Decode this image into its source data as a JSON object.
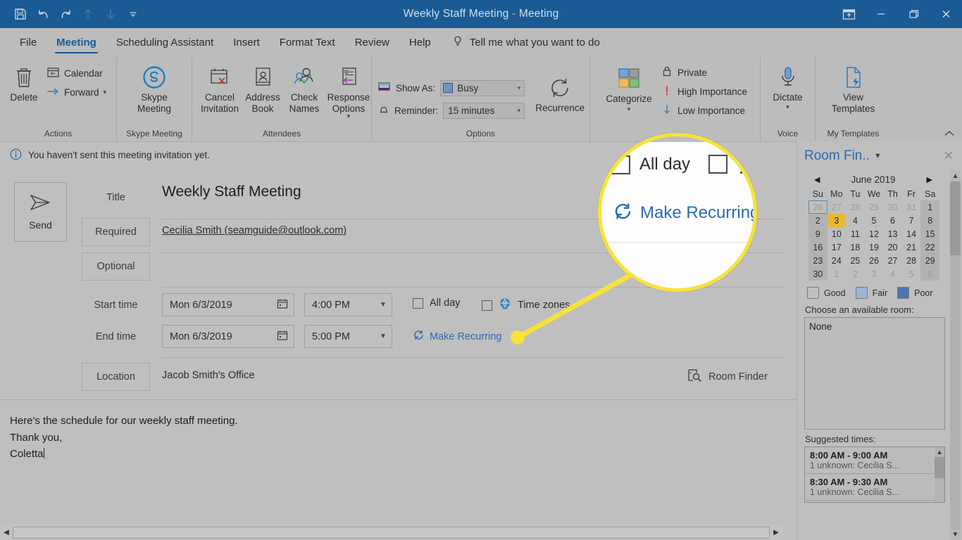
{
  "window": {
    "title": "Weekly Staff Meeting",
    "title_separator": "-",
    "title_suffix": "Meeting",
    "quick_access": [
      {
        "name": "save-icon",
        "label": "Save"
      },
      {
        "name": "undo-icon",
        "label": "Undo"
      },
      {
        "name": "redo-icon",
        "label": "Redo"
      },
      {
        "name": "previous-item-icon",
        "label": "Previous Item"
      },
      {
        "name": "next-item-icon",
        "label": "Next Item"
      },
      {
        "name": "customize-quick-access-toolbar-icon",
        "label": "Customize Quick Access Toolbar"
      }
    ],
    "controls": [
      {
        "name": "ribbon-display-options-icon",
        "label": "Ribbon Display Options"
      },
      {
        "name": "minimize-icon",
        "label": "Minimize"
      },
      {
        "name": "restore-icon",
        "label": "Restore Down"
      },
      {
        "name": "close-icon",
        "label": "Close"
      }
    ]
  },
  "tabs": [
    {
      "label": "File",
      "active": false
    },
    {
      "label": "Meeting",
      "active": true
    },
    {
      "label": "Scheduling Assistant",
      "active": false
    },
    {
      "label": "Insert",
      "active": false
    },
    {
      "label": "Format Text",
      "active": false
    },
    {
      "label": "Review",
      "active": false
    },
    {
      "label": "Help",
      "active": false
    }
  ],
  "tell_me": {
    "label": "Tell me what you want to do",
    "icon": "lightbulb-icon"
  },
  "ribbon": {
    "collapse_label": "Collapse the Ribbon",
    "groups": [
      {
        "label": "Actions",
        "buttons": [
          {
            "label": "Delete",
            "type": "big",
            "icon": "trash-icon"
          },
          {
            "label": "Calendar",
            "type": "small",
            "icon": "calendar-icon"
          },
          {
            "label": "Forward",
            "type": "small",
            "icon": "forward-arrow-icon",
            "dropdown": true
          }
        ]
      },
      {
        "label": "Skype Meeting",
        "buttons": [
          {
            "label": "Skype\nMeeting",
            "type": "big",
            "icon": "skype-icon"
          }
        ]
      },
      {
        "label": "Attendees",
        "buttons": [
          {
            "label": "Cancel\nInvitation",
            "type": "big",
            "icon": "cancel-invitation-icon"
          },
          {
            "label": "Address\nBook",
            "type": "big",
            "icon": "address-book-icon"
          },
          {
            "label": "Check\nNames",
            "type": "big",
            "icon": "check-names-icon"
          },
          {
            "label": "Response\nOptions",
            "type": "big",
            "icon": "response-options-icon",
            "dropdown": true
          }
        ]
      },
      {
        "label": "Options",
        "show_as_label": "Show As:",
        "show_as_value": "Busy",
        "reminder_label": "Reminder:",
        "reminder_value": "15 minutes",
        "recurrence_label": "Recurrence",
        "recurrence_icon": "recurrence-icon"
      },
      {
        "label": "",
        "categorize_label": "Categorize",
        "categorize_icon": "categorize-icon",
        "private_label": "Private",
        "private_icon": "lock-icon",
        "high_importance_label": "High Importance",
        "high_importance_icon": "high-importance-icon",
        "low_importance_label": "Low Importance",
        "low_importance_icon": "low-importance-icon"
      },
      {
        "label": "Voice",
        "buttons": [
          {
            "label": "Dictate",
            "type": "big",
            "icon": "microphone-icon",
            "dropdown": true
          }
        ]
      },
      {
        "label": "My Templates",
        "buttons": [
          {
            "label": "View\nTemplates",
            "type": "big",
            "icon": "view-templates-icon"
          }
        ]
      }
    ]
  },
  "infobar": {
    "icon": "info-icon",
    "text": "You haven't sent this meeting invitation yet."
  },
  "form": {
    "send_label": "Send",
    "send_icon": "send-arrow-icon",
    "title_label": "Title",
    "title_value": "Weekly Staff Meeting",
    "required_label": "Required",
    "required_value": "Cecilia Smith (seamguide@outlook.com)",
    "optional_label": "Optional",
    "optional_value": "",
    "start_time_label": "Start time",
    "start_date": "Mon 6/3/2019",
    "start_time": "4:00 PM",
    "end_time_label": "End time",
    "end_date": "Mon 6/3/2019",
    "end_time": "5:00 PM",
    "all_day_label": "All day",
    "all_day_checked": false,
    "time_zones_label": "Time zones",
    "time_zones_checked": false,
    "time_zones_icon": "globe-icon",
    "make_recurring_label": "Make Recurring",
    "make_recurring_icon": "recurrence-icon",
    "location_label": "Location",
    "location_value": "Jacob Smith's Office",
    "room_finder_label": "Room Finder",
    "room_finder_icon": "room-finder-icon",
    "calendar_picker_icon": "calendar-picker-icon",
    "dropdown_icon": "chevron-down-icon"
  },
  "body": {
    "lines": [
      "Here's the schedule for our weekly staff meeting.",
      "Thank you,",
      "Coletta"
    ]
  },
  "room_finder": {
    "title": "Room Fin..",
    "dropdown_icon": "chevron-down-icon",
    "close_icon": "close-icon",
    "month": "June 2019",
    "prev_icon": "prev-month-icon",
    "next_icon": "next-month-icon",
    "weekdays": [
      "Su",
      "Mo",
      "Tu",
      "We",
      "Th",
      "Fr",
      "Sa"
    ],
    "weeks": [
      [
        {
          "d": "26",
          "dim": true,
          "today": true
        },
        {
          "d": "27",
          "dim": true
        },
        {
          "d": "28",
          "dim": true
        },
        {
          "d": "29",
          "dim": true
        },
        {
          "d": "30",
          "dim": true
        },
        {
          "d": "31",
          "dim": true
        },
        {
          "d": "1",
          "wk": true
        }
      ],
      [
        {
          "d": "2",
          "wk": true
        },
        {
          "d": "3",
          "sel": true
        },
        {
          "d": "4"
        },
        {
          "d": "5"
        },
        {
          "d": "6"
        },
        {
          "d": "7"
        },
        {
          "d": "8",
          "wk": true
        }
      ],
      [
        {
          "d": "9",
          "wk": true
        },
        {
          "d": "10"
        },
        {
          "d": "11"
        },
        {
          "d": "12"
        },
        {
          "d": "13"
        },
        {
          "d": "14"
        },
        {
          "d": "15",
          "wk": true
        }
      ],
      [
        {
          "d": "16",
          "wk": true
        },
        {
          "d": "17"
        },
        {
          "d": "18"
        },
        {
          "d": "19"
        },
        {
          "d": "20"
        },
        {
          "d": "21"
        },
        {
          "d": "22",
          "wk": true
        }
      ],
      [
        {
          "d": "23",
          "wk": true
        },
        {
          "d": "24"
        },
        {
          "d": "25"
        },
        {
          "d": "26"
        },
        {
          "d": "27"
        },
        {
          "d": "28"
        },
        {
          "d": "29",
          "wk": true
        }
      ],
      [
        {
          "d": "30",
          "wk": true
        },
        {
          "d": "1",
          "dim": true
        },
        {
          "d": "2",
          "dim": true
        },
        {
          "d": "3",
          "dim": true
        },
        {
          "d": "4",
          "dim": true
        },
        {
          "d": "5",
          "dim": true
        },
        {
          "d": "6",
          "dim": true,
          "wk": true
        }
      ]
    ],
    "legend": [
      {
        "label": "Good",
        "color": "transparent"
      },
      {
        "label": "Fair",
        "color": "#9db4d4"
      },
      {
        "label": "Poor",
        "color": "#4a77ad"
      }
    ],
    "choose_room_label": "Choose an available room:",
    "room_list": [
      "None"
    ],
    "suggested_label": "Suggested times:",
    "suggested": [
      {
        "time": "8:00 AM - 9:00 AM",
        "detail": "1 unknown: Cecilia S..."
      },
      {
        "time": "8:30 AM - 9:30 AM",
        "detail": "1 unknown: Cecilia S..."
      }
    ]
  },
  "callout": {
    "all_day_label": "All day",
    "make_recurring_label": "Make Recurring",
    "highlight_color": "#f8e23a"
  },
  "scrollbar": {
    "left_arrow": "◀",
    "right_arrow": "▶"
  },
  "colors": {
    "titlebar": "#1a5b96",
    "ribbon": "#bcbcbc",
    "page": "#bfbfbf",
    "accent_blue": "#2a6bb0",
    "highlight_yellow": "#f8e23a",
    "selected_day": "#e8b735"
  }
}
